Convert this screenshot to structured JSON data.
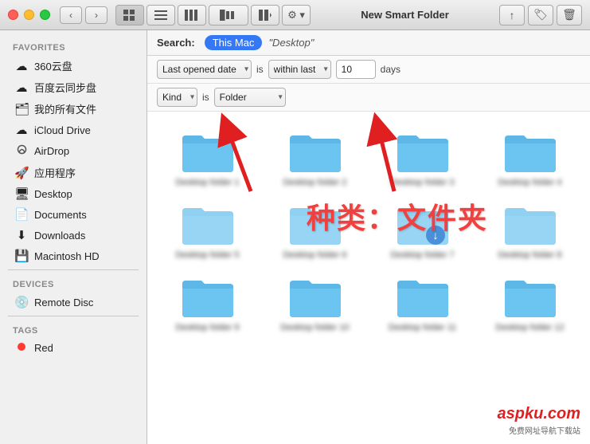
{
  "titlebar": {
    "title": "New Smart Folder",
    "traffic_lights": [
      "close",
      "minimize",
      "maximize"
    ],
    "nav_back": "‹",
    "nav_forward": "›"
  },
  "toolbar": {
    "view_icons": "⊞",
    "view_list": "≡",
    "view_columns": "⊟",
    "view_cover": "⊞⊟",
    "view_options": "⚙",
    "share": "↑",
    "tag": "🏷",
    "action": "⚙",
    "trash": "🗑"
  },
  "search": {
    "label": "Search:",
    "scope_this_mac": "This Mac",
    "scope_desktop": "\"Desktop\""
  },
  "filter1": {
    "field": "Last opened date",
    "operator": "is",
    "condition": "within last",
    "value": "10",
    "unit": "days"
  },
  "filter2": {
    "field": "Kind",
    "operator": "is",
    "value": "Folder"
  },
  "sidebar": {
    "favorites_label": "Favorites",
    "items": [
      {
        "id": "360",
        "label": "360云盘",
        "icon": "☁"
      },
      {
        "id": "baidu",
        "label": "百度云同步盘",
        "icon": "☁"
      },
      {
        "id": "myfiles",
        "label": "我的所有文件",
        "icon": "🗂"
      },
      {
        "id": "icloud",
        "label": "iCloud Drive",
        "icon": "☁"
      },
      {
        "id": "airdrop",
        "label": "AirDrop",
        "icon": "📡"
      },
      {
        "id": "apps",
        "label": "应用程序",
        "icon": "🚀"
      },
      {
        "id": "desktop",
        "label": "Desktop",
        "icon": "🖥"
      },
      {
        "id": "documents",
        "label": "Documents",
        "icon": "📄"
      },
      {
        "id": "downloads",
        "label": "Downloads",
        "icon": "⬇"
      },
      {
        "id": "macintosh",
        "label": "Macintosh HD",
        "icon": "💾"
      }
    ],
    "devices_label": "Devices",
    "devices": [
      {
        "id": "remotedisc",
        "label": "Remote Disc",
        "icon": "💿"
      }
    ],
    "tags_label": "Tags",
    "tags": [
      {
        "id": "red",
        "label": "Red",
        "color": "#ff3b30"
      }
    ]
  },
  "files": [
    {
      "name": "Desktop folder 1",
      "has_badge": false
    },
    {
      "name": "Desktop folder 2",
      "has_badge": false
    },
    {
      "name": "Desktop folder 3",
      "has_badge": false
    },
    {
      "name": "Desktop folder 4",
      "has_badge": false
    },
    {
      "name": "Desktop folder 5",
      "has_badge": false
    },
    {
      "name": "Desktop folder 6",
      "has_badge": false
    },
    {
      "name": "Desktop folder 7",
      "has_badge": true
    },
    {
      "name": "Desktop folder 8",
      "has_badge": false
    },
    {
      "name": "Desktop folder 9",
      "has_badge": false
    },
    {
      "name": "Desktop folder 10",
      "has_badge": false
    },
    {
      "name": "Desktop folder 11",
      "has_badge": false
    },
    {
      "name": "Desktop folder 12",
      "has_badge": false
    }
  ],
  "annotation": {
    "text": "种类：文件夹"
  },
  "watermark": {
    "text": "aspku",
    "subtext": ".com"
  }
}
